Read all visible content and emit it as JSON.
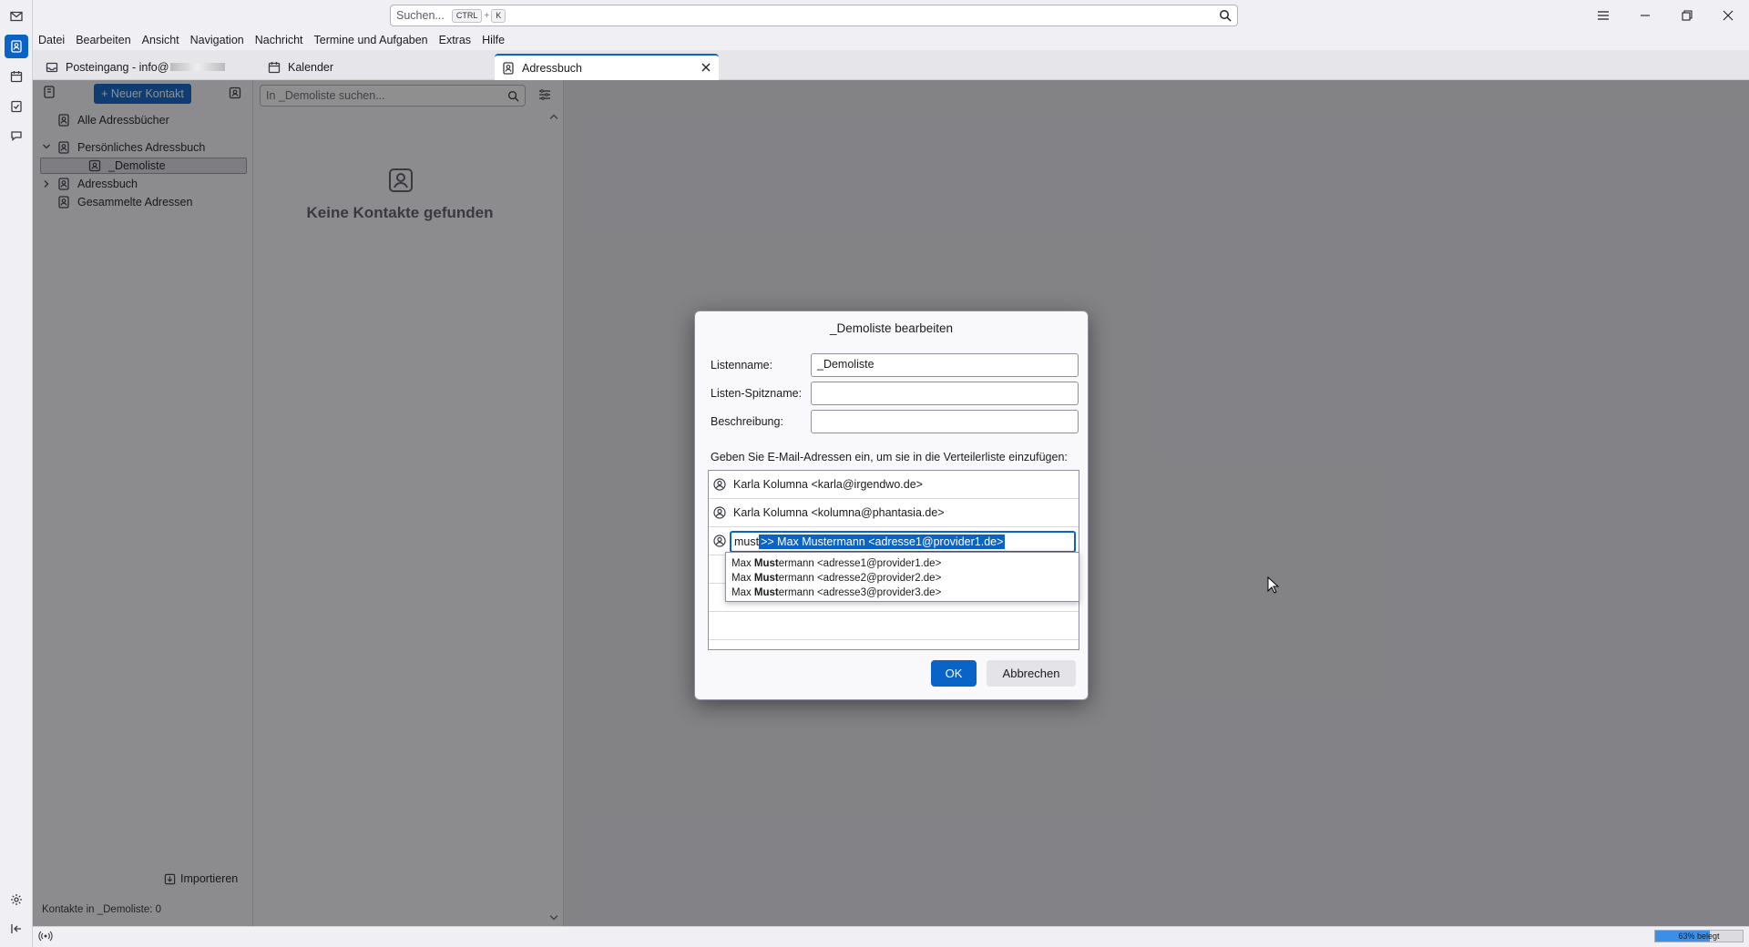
{
  "titlebar": {
    "search_placeholder": "Suchen...",
    "shortcut_ctrl": "CTRL",
    "shortcut_plus": "+",
    "shortcut_key": "K"
  },
  "menu": [
    "Datei",
    "Bearbeiten",
    "Ansicht",
    "Navigation",
    "Nachricht",
    "Termine und Aufgaben",
    "Extras",
    "Hilfe"
  ],
  "tabs": [
    {
      "label": "Posteingang - info@"
    },
    {
      "label": "Kalender"
    },
    {
      "label": "Adressbuch"
    }
  ],
  "sidebar": {
    "new_contact": "+ Neuer Kontakt",
    "items": [
      {
        "label": "Alle Adressbücher"
      },
      {
        "label": "Persönliches Adressbuch"
      },
      {
        "label": "_Demoliste"
      },
      {
        "label": "Adressbuch"
      },
      {
        "label": "Gesammelte Adressen"
      }
    ],
    "import": "Importieren",
    "status": "Kontakte in _Demoliste: 0"
  },
  "list": {
    "search_placeholder": "In _Demoliste suchen...",
    "empty": "Keine Kontakte gefunden"
  },
  "dialog": {
    "title": "_Demoliste bearbeiten",
    "listname_label": "Listenname:",
    "listname_value": "_Demoliste",
    "nickname_label": "Listen-Spitzname:",
    "nickname_value": "",
    "description_label": "Beschreibung:",
    "description_value": "",
    "instruction": "Geben Sie E-Mail-Adressen ein, um sie in die Verteilerliste einzufügen:",
    "entries": [
      "Karla Kolumna <karla@irgendwo.de>",
      "Karla Kolumna <kolumna@phantasia.de>"
    ],
    "typed": "must",
    "suggestion": ">> Max Mustermann <adresse1@provider1.de>",
    "popup": [
      {
        "pre": "Max ",
        "bold": "Must",
        "post": "ermann <adresse1@provider1.de>"
      },
      {
        "pre": "Max ",
        "bold": "Must",
        "post": "ermann <adresse2@provider2.de>"
      },
      {
        "pre": "Max ",
        "bold": "Must",
        "post": "ermann <adresse3@provider3.de>"
      }
    ],
    "ok": "OK",
    "cancel": "Abbrechen"
  },
  "statusbar": {
    "quota": "63% belegt",
    "quota_fraction": 0.63
  },
  "colors": {
    "accent": "#0a63c6"
  }
}
